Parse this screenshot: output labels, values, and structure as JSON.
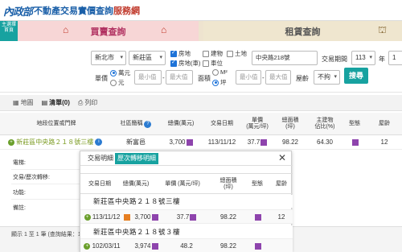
{
  "header": {
    "logo_mark": "內政部",
    "title_part1": "不動產交易實價查詢",
    "title_part2": "服務網"
  },
  "tabs": {
    "side_label": "主選擇首頁",
    "buy": "買賣查詢",
    "rent": "租賃查詢"
  },
  "filters": {
    "city": "新北市",
    "district": "新莊區",
    "types": [
      {
        "label": "房地",
        "checked": true
      },
      {
        "label": "建物",
        "checked": false
      },
      {
        "label": "土地",
        "checked": false
      },
      {
        "label": "房地(車)",
        "checked": true
      },
      {
        "label": "車位",
        "checked": false
      }
    ],
    "address_value": "中央路218號",
    "period_label": "交易期間",
    "year_value": "113",
    "year_unit": "年",
    "month_value": "1",
    "price_unit_label": "單價",
    "unit_wan": "萬元",
    "unit_yuan": "元",
    "min_placeholder": "最小值",
    "max_placeholder": "最大值",
    "area_label": "面積",
    "area_m2": "M²",
    "area_ping": "坪",
    "age_label": "屋齡",
    "age_value": "不拘",
    "search_button": "搜尋",
    "dash": "-"
  },
  "toolbar": {
    "map": "地圖",
    "list": "清單(0)",
    "print": "列印"
  },
  "main_table": {
    "headers": [
      "地段位置或門牌",
      "社區簡稱",
      "總價(萬元)",
      "交易日期",
      "單價\n(萬元/坪)",
      "總面積\n(坪)",
      "主建物\n佔比(%)",
      "型態",
      "屋齡"
    ],
    "row": {
      "address": "新莊區中央路２１８號三樓",
      "community": "新富邑",
      "total": "3,700",
      "date": "113/11/12",
      "unit": "37.7",
      "area": "98.22",
      "main_ratio": "64.30",
      "age": "12"
    }
  },
  "detail_labels": [
    "電梯:",
    "交易/歷次轉移:",
    "功能:",
    "備註:"
  ],
  "footer": {
    "text": "顯示 1 至 1 筆 (查詢結果：1"
  },
  "modal": {
    "tab_detail": "交易明細",
    "tab_history": "歷次轉移明細",
    "headers": [
      "交易日期",
      "總價(萬元)",
      "單價 (萬元/坪)",
      "總面積\n(坪)",
      "型態",
      "屋齡"
    ],
    "groups": [
      {
        "address": "新莊區中央路２１８號三樓",
        "date": "113/11/12",
        "total": "3,700",
        "unit": "37.7",
        "area": "98.22",
        "age": "12"
      },
      {
        "address": "新莊區中央路２１８號３樓",
        "date": "102/03/11",
        "total": "3,974",
        "unit": "48.2",
        "area": "98.22",
        "age": ""
      }
    ]
  }
}
